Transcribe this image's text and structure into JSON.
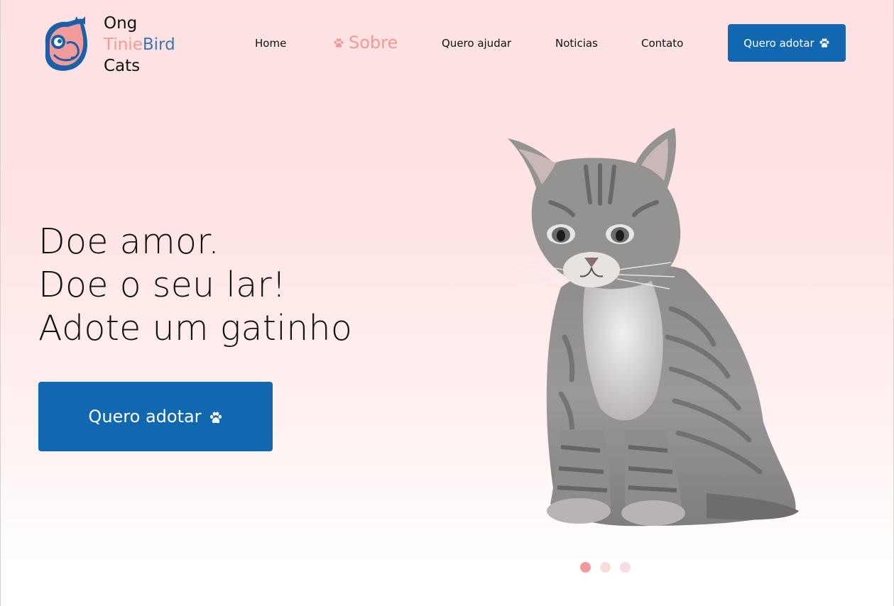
{
  "brand": {
    "line1": "Ong",
    "line2_part1": "Tinie",
    "line2_part2": "Bird",
    "line3": "Cats",
    "colors": {
      "pink": "#f39a9a",
      "blue": "#3e74b8"
    }
  },
  "nav": {
    "items": [
      {
        "label": "Home",
        "active": false
      },
      {
        "label": "Sobre",
        "active": true,
        "icon": "paw-icon"
      },
      {
        "label": "Quero ajudar",
        "active": false
      },
      {
        "label": "Noticias",
        "active": false
      },
      {
        "label": "Contato",
        "active": false
      }
    ],
    "cta_label": "Quero adotar",
    "cta_icon": "paw-icon"
  },
  "hero": {
    "lines": [
      "Doe amor.",
      "Doe o seu lar!",
      "Adote um gatinho"
    ],
    "cta_label": "Quero adotar",
    "cta_icon": "paw-icon",
    "image": "gray-tabby-kitten"
  },
  "carousel": {
    "slides": 3,
    "active_index": 0
  },
  "colors": {
    "primary_button": "#1168b1",
    "accent_pink": "#f29a9a",
    "dot_inactive": "#fbdcdc",
    "background_top": "#ffe1e1"
  }
}
